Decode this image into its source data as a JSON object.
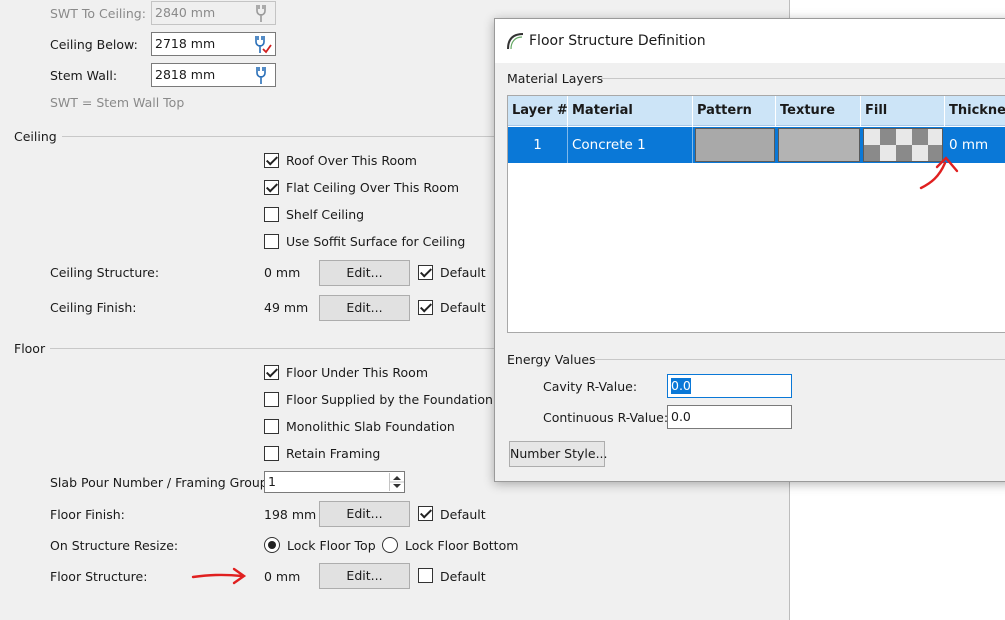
{
  "main": {
    "swt_to_ceiling": {
      "label": "SWT To Ceiling:",
      "value": "2840 mm"
    },
    "ceiling_below": {
      "label": "Ceiling Below:",
      "value": "2718 mm"
    },
    "stem_wall": {
      "label": "Stem Wall:",
      "value": "2818 mm"
    },
    "swt_note": "SWT = Stem Wall Top",
    "ceiling_section": "Ceiling",
    "ceiling_checks": [
      {
        "label": "Roof Over This Room",
        "checked": true
      },
      {
        "label": "Flat Ceiling Over This Room",
        "checked": true
      },
      {
        "label": "Shelf Ceiling",
        "checked": false
      },
      {
        "label": "Use Soffit Surface for Ceiling",
        "checked": false
      }
    ],
    "ceiling_structure": {
      "label": "Ceiling Structure:",
      "value": "0 mm",
      "button": "Edit...",
      "default_label": "Default",
      "default_checked": true
    },
    "ceiling_finish": {
      "label": "Ceiling Finish:",
      "value": "49 mm",
      "button": "Edit...",
      "default_label": "Default",
      "default_checked": true
    },
    "floor_section": "Floor",
    "floor_checks": [
      {
        "label": "Floor Under This Room",
        "checked": true
      },
      {
        "label": "Floor Supplied by the Foundation Roo",
        "checked": false
      },
      {
        "label": "Monolithic Slab Foundation",
        "checked": false
      },
      {
        "label": "Retain Framing",
        "checked": false
      }
    ],
    "slab_pour": {
      "label": "Slab Pour Number / Framing Group:",
      "value": "1"
    },
    "floor_finish": {
      "label": "Floor Finish:",
      "value": "198 mm",
      "button": "Edit...",
      "default_label": "Default",
      "default_checked": true
    },
    "on_structure_resize": {
      "label": "On Structure Resize:",
      "option_top": "Lock Floor Top",
      "option_bottom": "Lock Floor Bottom",
      "selected": "top"
    },
    "floor_structure": {
      "label": "Floor Structure:",
      "value": "0 mm",
      "button": "Edit...",
      "default_label": "Default",
      "default_checked": false
    }
  },
  "dialog": {
    "title": "Floor Structure Definition",
    "material_layers_label": "Material Layers",
    "columns": [
      "Layer #",
      "Material",
      "Pattern",
      "Texture",
      "Fill",
      "Thickness"
    ],
    "rows": [
      {
        "layer": "1",
        "material": "Concrete 1",
        "thickness": "0 mm"
      }
    ],
    "energy_label": "Energy Values",
    "cavity_r": {
      "label": "Cavity R-Value:",
      "value": "0.0"
    },
    "continuous_r": {
      "label": "Continuous R-Value:",
      "value": "0.0"
    },
    "number_style_button": "Number Style..."
  },
  "colors": {
    "selection": "#0a78d7",
    "header": "#cce4f7",
    "annotation": "#e02020"
  }
}
